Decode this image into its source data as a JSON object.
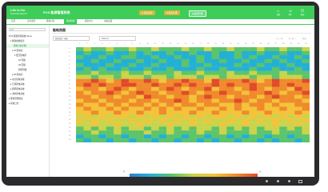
{
  "header": {
    "logo": {
      "brand": "Life Is On",
      "name": "Schneider Electric"
    },
    "app_title": "PCS 能源管理系统",
    "actions": [
      {
        "label": "■ 系统设置"
      },
      {
        "label": "■ 报表管理"
      },
      {
        "label": "■ 报警管理"
      }
    ],
    "icons": [
      {
        "icon": "home-icon",
        "glyph": "⌂",
        "label": "首页"
      },
      {
        "icon": "user-icon",
        "glyph": "☺",
        "label": "用户"
      },
      {
        "icon": "logout-icon",
        "glyph": "⏻",
        "label": "退出"
      }
    ]
  },
  "nav": {
    "items": [
      {
        "label": "首页"
      },
      {
        "label": "实时监控"
      },
      {
        "label": "能耗分析"
      },
      {
        "label": "能耗热图"
      },
      {
        "label": "报表中心"
      },
      {
        "label": "系统设置"
      }
    ],
    "active_index": 3
  },
  "sidebar": {
    "search_placeholder": "搜索",
    "items": [
      {
        "label": "PCS 能源管理系统 demo"
      },
      {
        "label": "▾ 能耗热图总览"
      },
      {
        "label": "能耗日热力图"
      },
      {
        "label": "▾ 1# 配电房"
      },
      {
        "label": "▾ 低压配电柜"
      },
      {
        "label": "1# 回路"
      },
      {
        "label": "2# 回路"
      },
      {
        "label": "照明回路"
      },
      {
        "label": "▸ 2# 配电房"
      },
      {
        "label": "▸ 动力配电系统"
      },
      {
        "label": "▸ 空调配电系统"
      },
      {
        "label": "▸ 照明配电系统"
      },
      {
        "label": "▸ 消防配电系统"
      },
      {
        "label": "▸ 能源管理报表"
      },
      {
        "label": "▸ 系统日志"
      }
    ]
  },
  "content": {
    "title": "能耗热图",
    "fields": [
      {
        "label": "能耗类型: 电能"
      },
      {
        "label": "2022-01"
      }
    ],
    "right_links": [
      {
        "label": "◁ 上一月"
      },
      {
        "label": "下一月 ▷"
      },
      {
        "label": "导出"
      }
    ]
  },
  "chart_data": {
    "type": "heatmap",
    "columns": [
      "1",
      "2",
      "3",
      "4",
      "5",
      "6",
      "7",
      "8",
      "9",
      "10",
      "11",
      "12",
      "13",
      "14",
      "15",
      "16",
      "17",
      "18",
      "19",
      "20",
      "21",
      "22",
      "23",
      "24",
      "25",
      "26",
      "27",
      "28",
      "29",
      "30",
      "31"
    ],
    "rows": [
      "0",
      "1",
      "2",
      "3",
      "4",
      "5",
      "6",
      "7",
      "8",
      "9",
      "10",
      "11",
      "12",
      "13",
      "14",
      "15",
      "16",
      "17",
      "18",
      "19",
      "20",
      "21",
      "22",
      "23"
    ],
    "colorscale": [
      "#2e7fd0",
      "#24b0d6",
      "#5cc46a",
      "#c9d44a",
      "#f3c33a",
      "#f08a2c",
      "#e04b2a"
    ],
    "legend": {
      "min_label": "低",
      "max_label": "高"
    },
    "values": [
      [
        2,
        3,
        2,
        2,
        3,
        2,
        2,
        3,
        2,
        2,
        3,
        2,
        2,
        2,
        3,
        2,
        2,
        3,
        2,
        2,
        3,
        2,
        2,
        2,
        3,
        2,
        2,
        3,
        2,
        2,
        3
      ],
      [
        1,
        2,
        1,
        1,
        2,
        1,
        1,
        2,
        1,
        2,
        1,
        1,
        2,
        1,
        1,
        2,
        1,
        1,
        2,
        1,
        1,
        2,
        1,
        1,
        2,
        1,
        1,
        2,
        1,
        1,
        2
      ],
      [
        2,
        1,
        1,
        2,
        1,
        1,
        2,
        2,
        1,
        1,
        2,
        1,
        1,
        2,
        1,
        1,
        2,
        1,
        2,
        1,
        1,
        2,
        1,
        2,
        1,
        1,
        2,
        1,
        1,
        2,
        1
      ],
      [
        1,
        1,
        2,
        1,
        1,
        2,
        1,
        1,
        2,
        1,
        1,
        2,
        1,
        1,
        2,
        1,
        2,
        1,
        1,
        2,
        1,
        1,
        2,
        1,
        1,
        2,
        1,
        2,
        1,
        1,
        2
      ],
      [
        2,
        1,
        1,
        1,
        2,
        1,
        1,
        2,
        1,
        1,
        2,
        1,
        1,
        1,
        2,
        1,
        1,
        2,
        1,
        1,
        1,
        2,
        1,
        1,
        2,
        1,
        1,
        1,
        2,
        1,
        1
      ],
      [
        1,
        2,
        1,
        2,
        1,
        1,
        2,
        1,
        1,
        2,
        1,
        1,
        2,
        1,
        1,
        1,
        2,
        1,
        1,
        2,
        1,
        1,
        1,
        2,
        1,
        1,
        2,
        1,
        1,
        2,
        1
      ],
      [
        2,
        2,
        3,
        2,
        2,
        2,
        3,
        2,
        2,
        3,
        2,
        2,
        2,
        3,
        2,
        2,
        3,
        2,
        2,
        2,
        3,
        2,
        2,
        3,
        2,
        2,
        2,
        3,
        2,
        2,
        2
      ],
      [
        3,
        3,
        2,
        3,
        3,
        2,
        3,
        3,
        3,
        2,
        3,
        3,
        2,
        3,
        3,
        3,
        2,
        3,
        3,
        2,
        3,
        3,
        3,
        2,
        3,
        3,
        2,
        3,
        3,
        3,
        2
      ],
      [
        5,
        5,
        6,
        5,
        4,
        5,
        6,
        5,
        5,
        6,
        5,
        4,
        5,
        5,
        6,
        5,
        5,
        4,
        6,
        5,
        5,
        5,
        6,
        5,
        4,
        5,
        6,
        5,
        5,
        5,
        6
      ],
      [
        5,
        6,
        5,
        6,
        5,
        5,
        6,
        6,
        5,
        5,
        6,
        5,
        5,
        6,
        5,
        6,
        5,
        5,
        6,
        5,
        6,
        5,
        5,
        6,
        5,
        5,
        6,
        5,
        6,
        5,
        5
      ],
      [
        4,
        5,
        5,
        4,
        5,
        6,
        5,
        4,
        5,
        5,
        4,
        5,
        6,
        5,
        4,
        5,
        5,
        6,
        4,
        5,
        5,
        4,
        5,
        6,
        5,
        4,
        5,
        5,
        4,
        6,
        5
      ],
      [
        5,
        4,
        5,
        5,
        6,
        5,
        4,
        5,
        6,
        5,
        5,
        4,
        5,
        5,
        6,
        5,
        4,
        5,
        5,
        6,
        5,
        5,
        4,
        5,
        5,
        6,
        5,
        4,
        5,
        5,
        6
      ],
      [
        5,
        5,
        4,
        5,
        5,
        4,
        5,
        5,
        4,
        6,
        5,
        5,
        4,
        5,
        5,
        4,
        5,
        6,
        5,
        5,
        4,
        5,
        5,
        5,
        4,
        5,
        6,
        5,
        5,
        4,
        5
      ],
      [
        4,
        5,
        5,
        4,
        5,
        5,
        5,
        4,
        5,
        5,
        4,
        5,
        5,
        6,
        5,
        4,
        5,
        5,
        4,
        5,
        5,
        6,
        5,
        4,
        5,
        5,
        4,
        5,
        5,
        5,
        4
      ],
      [
        5,
        4,
        4,
        5,
        4,
        5,
        4,
        5,
        5,
        4,
        5,
        4,
        5,
        4,
        5,
        5,
        4,
        5,
        5,
        4,
        4,
        5,
        4,
        5,
        5,
        4,
        5,
        4,
        4,
        5,
        5
      ],
      [
        4,
        5,
        4,
        4,
        5,
        4,
        5,
        4,
        4,
        5,
        4,
        5,
        4,
        5,
        4,
        4,
        5,
        4,
        4,
        5,
        4,
        5,
        4,
        4,
        5,
        4,
        4,
        5,
        4,
        4,
        5
      ],
      [
        4,
        4,
        5,
        4,
        4,
        5,
        4,
        4,
        5,
        4,
        4,
        5,
        4,
        4,
        4,
        5,
        4,
        4,
        5,
        4,
        4,
        4,
        5,
        4,
        4,
        5,
        4,
        4,
        4,
        5,
        4
      ],
      [
        3,
        4,
        3,
        4,
        3,
        4,
        4,
        3,
        4,
        3,
        4,
        3,
        4,
        3,
        4,
        3,
        4,
        3,
        4,
        4,
        3,
        4,
        3,
        4,
        3,
        4,
        3,
        4,
        3,
        4,
        3
      ],
      [
        4,
        3,
        4,
        3,
        4,
        3,
        3,
        4,
        3,
        4,
        3,
        4,
        3,
        4,
        3,
        4,
        3,
        4,
        3,
        3,
        4,
        3,
        4,
        3,
        4,
        3,
        4,
        3,
        4,
        3,
        4
      ],
      [
        3,
        3,
        4,
        3,
        3,
        4,
        3,
        3,
        4,
        3,
        3,
        3,
        4,
        3,
        3,
        4,
        3,
        3,
        3,
        4,
        3,
        3,
        4,
        3,
        3,
        3,
        4,
        3,
        3,
        4,
        3
      ],
      [
        2,
        3,
        2,
        3,
        2,
        3,
        2,
        3,
        3,
        2,
        3,
        2,
        3,
        2,
        3,
        2,
        3,
        3,
        2,
        3,
        2,
        3,
        2,
        3,
        2,
        3,
        3,
        2,
        3,
        2,
        3
      ],
      [
        2,
        2,
        3,
        2,
        2,
        3,
        2,
        2,
        2,
        3,
        2,
        2,
        3,
        2,
        2,
        2,
        3,
        2,
        2,
        3,
        2,
        2,
        2,
        3,
        2,
        2,
        3,
        2,
        2,
        2,
        3
      ],
      [
        1,
        2,
        2,
        1,
        2,
        2,
        1,
        2,
        2,
        1,
        2,
        1,
        2,
        2,
        1,
        2,
        2,
        1,
        2,
        2,
        1,
        2,
        1,
        2,
        2,
        1,
        2,
        2,
        1,
        2,
        2
      ],
      [
        2,
        1,
        2,
        2,
        1,
        2,
        2,
        1,
        2,
        2,
        1,
        2,
        2,
        1,
        2,
        2,
        1,
        2,
        1,
        2,
        2,
        1,
        2,
        2,
        1,
        2,
        1,
        2,
        2,
        1,
        2
      ]
    ]
  }
}
